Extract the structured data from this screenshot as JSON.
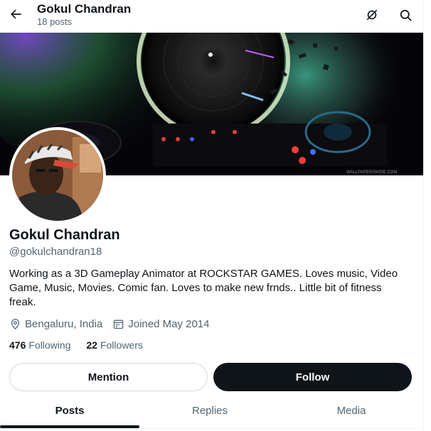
{
  "header": {
    "title": "Gokul Chandran",
    "post_count": "18 posts",
    "icons": [
      "back-arrow-icon",
      "grok-icon",
      "search-icon"
    ]
  },
  "banner": {
    "watermark": "WALLPAPERSWIDE.COM"
  },
  "profile": {
    "name": "Gokul Chandran",
    "handle": "@gokulchandran18",
    "bio": "Working as a 3D Gameplay Animator at ROCKSTAR GAMES.  Loves music, Video Game, Music, Movies. Comic fan. Loves to make new frnds..  Little bit of fitness freak.",
    "location": "Bengaluru, India",
    "joined": "Joined May 2014",
    "following_count": "476",
    "following_label": "Following",
    "followers_count": "22",
    "followers_label": "Followers"
  },
  "actions": {
    "mention_label": "Mention",
    "follow_label": "Follow"
  },
  "tabs": [
    {
      "label": "Posts",
      "active": true
    },
    {
      "label": "Replies",
      "active": false
    },
    {
      "label": "Media",
      "active": false
    }
  ],
  "colors": {
    "text_primary": "#0f1419",
    "text_secondary": "#536471",
    "button_dark": "#0f1419",
    "border": "#cfd9de"
  }
}
